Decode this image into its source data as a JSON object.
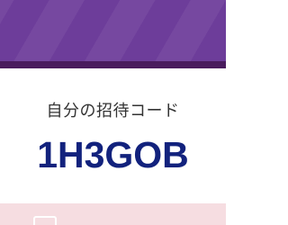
{
  "invite": {
    "label": "自分の招待コード",
    "code": "1H3GOB"
  },
  "colors": {
    "banner": "#6d3d9a",
    "banner_border": "#4a1c5e",
    "code_text": "#12227d",
    "bottom_background": "#f6dde1"
  },
  "icons": {
    "bottom": "clipboard-icon"
  }
}
